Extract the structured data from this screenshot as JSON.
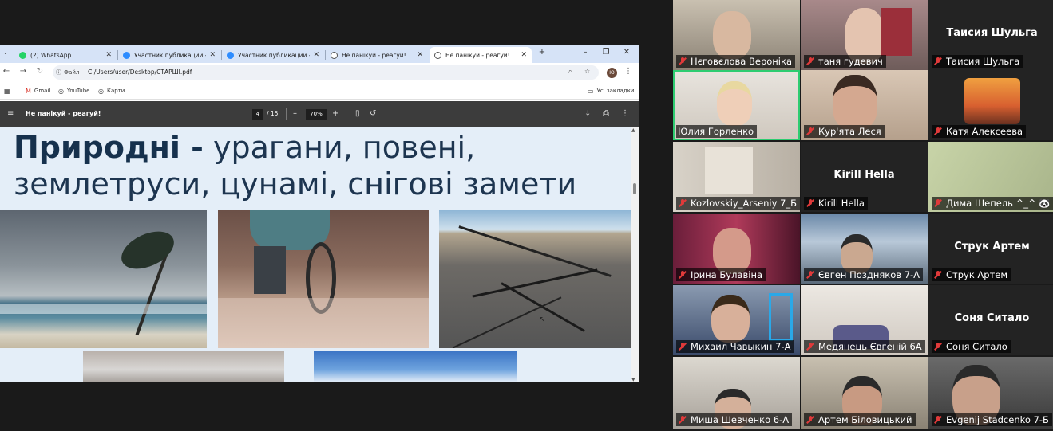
{
  "browser": {
    "tabs": [
      {
        "label": "(2) WhatsApp",
        "color": "#25d366"
      },
      {
        "label": "Участник публикации - Zoom",
        "color": "#2d8cff"
      },
      {
        "label": "Участник публикации - Zoom",
        "color": "#2d8cff"
      },
      {
        "label": "Не панікуй - реагуй!",
        "color": "#666666"
      },
      {
        "label": "Не панікуй - реагуй!",
        "color": "#666666"
      }
    ],
    "new_tab": "+",
    "address": {
      "chip": "Файл",
      "url": "C:/Users/user/Desktop/СТАРШІ.pdf"
    },
    "profile_initial": "Ю",
    "bookmarks": [
      {
        "label": "Gmail",
        "icon": "gmail-icon"
      },
      {
        "label": "YouTube",
        "icon": "youtube-icon"
      },
      {
        "label": "Карти",
        "icon": "maps-icon"
      }
    ],
    "all_bookmarks": "Усі закладки"
  },
  "pdf": {
    "title": "Не панікуй - реагуй!",
    "page_current": "4",
    "page_total": "/ 15",
    "zoom": "70%",
    "slide_heading_bold": "Природні -",
    "slide_heading_rest": " урагани, повені, землетруси, цунамі, снігові замети"
  },
  "zoom_gallery": {
    "tiles": [
      {
        "name": "Нєговєлова Вероніка",
        "video": true
      },
      {
        "name": "таня гудевич",
        "video": true
      },
      {
        "name": "Таисия Шульга",
        "video": false,
        "big_name": "Таисия Шульга"
      },
      {
        "name": "Юлия Горленко",
        "video": true,
        "active_speaker": true
      },
      {
        "name": "Кур'ята Леся",
        "video": true
      },
      {
        "name": "Катя Алексеева",
        "video": true
      },
      {
        "name": "Kozlovskiy_Arseniy 7_Б",
        "video": true
      },
      {
        "name": "Kirill Hella",
        "video": false,
        "big_name": "Kirill Hella"
      },
      {
        "name": "Дима Шепель ^_^ 🐼 Ш",
        "video": true
      },
      {
        "name": "Ірина Булавіна",
        "video": true
      },
      {
        "name": "Євген Поздняков 7-А",
        "video": true
      },
      {
        "name": "Струк Артем",
        "video": false,
        "big_name": "Струк Артем"
      },
      {
        "name": "Михаил Чавыкин 7-А",
        "video": true
      },
      {
        "name": "Медянець Євгеній 6А",
        "video": true
      },
      {
        "name": "Соня Ситало",
        "video": false,
        "big_name": "Соня Ситало"
      },
      {
        "name": "Миша Шевченко 6-А",
        "video": true
      },
      {
        "name": "Артем Біловицький",
        "video": true
      },
      {
        "name": "Evgenij Stadcenko 7-Б",
        "video": true
      }
    ]
  }
}
